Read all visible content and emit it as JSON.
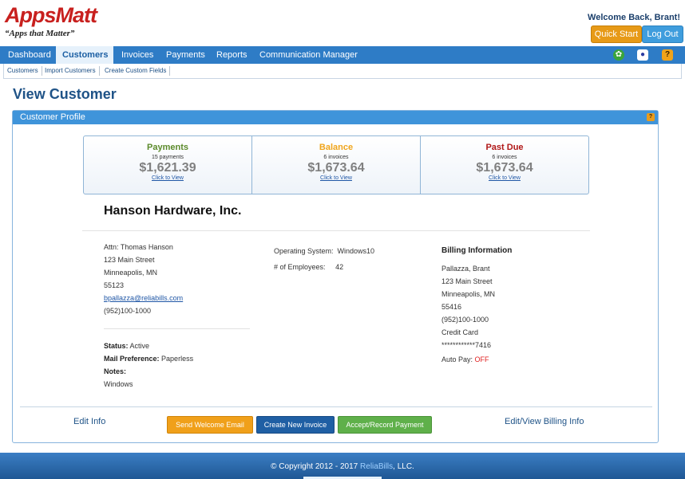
{
  "header": {
    "logo_text": "AppsMatt",
    "tagline": "“Apps that Matter”",
    "welcome": "Welcome Back, Brant!",
    "quick_start": "Quick Start",
    "logout": "Log Out"
  },
  "nav": {
    "items": [
      {
        "label": "Dashboard"
      },
      {
        "label": "Customers",
        "active": true
      },
      {
        "label": "Invoices"
      },
      {
        "label": "Payments"
      },
      {
        "label": "Reports"
      },
      {
        "label": "Communication Manager"
      }
    ],
    "icons": [
      "gear-icon",
      "user-icon",
      "help-icon"
    ]
  },
  "subnav": {
    "items": [
      {
        "label": "Customers"
      },
      {
        "label": "Import Customers"
      },
      {
        "label": "Create Custom Fields"
      }
    ]
  },
  "page_title": "View Customer",
  "panel": {
    "title": "Customer Profile",
    "help": "?",
    "stats": [
      {
        "label": "Payments",
        "sub": "15 payments",
        "amount": "$1,621.39",
        "link": "Click to View",
        "color": "#5b8a2a"
      },
      {
        "label": "Balance",
        "sub": "6 invoices",
        "amount": "$1,673.64",
        "link": "Click to View",
        "color": "#f0a51c"
      },
      {
        "label": "Past Due",
        "sub": "6 invoices",
        "amount": "$1,673.64",
        "link": "Click to View",
        "color": "#b11818"
      }
    ],
    "company": "Hanson Hardware, Inc.",
    "contact": {
      "attn": "Attn: Thomas Hanson",
      "street": "123 Main Street",
      "city": "Minneapolis, MN",
      "zip": "55123",
      "email": "bpallazza@reliabills.com",
      "phone": "(952)100-1000"
    },
    "details": {
      "os_label": "Operating System:",
      "os_value": "Windows10",
      "emp_label": "# of Employees:",
      "emp_value": "42"
    },
    "status": {
      "status_label": "Status:",
      "status_value": "Active",
      "mail_label": "Mail Preference:",
      "mail_value": "Paperless",
      "notes_label": "Notes:",
      "notes_value": "Windows"
    },
    "billing": {
      "title": "Billing Information",
      "name": "Pallazza, Brant",
      "street": "123 Main Street",
      "city": "Minneapolis, MN",
      "zip": "55416",
      "phone": "(952)100-1000",
      "method": "Credit Card",
      "card": "************7416",
      "autopay_label": "Auto Pay:",
      "autopay_value": "OFF"
    },
    "actions": {
      "edit_info": "Edit Info",
      "send_welcome": "Send Welcome Email",
      "create_invoice": "Create New Invoice",
      "accept_payment": "Accept/Record Payment",
      "edit_billing": "Edit/View Billing Info"
    }
  },
  "footer": {
    "copyright": "© Copyright 2012 - 2017",
    "brand": "ReliaBills",
    "suffix": ", LLC."
  }
}
